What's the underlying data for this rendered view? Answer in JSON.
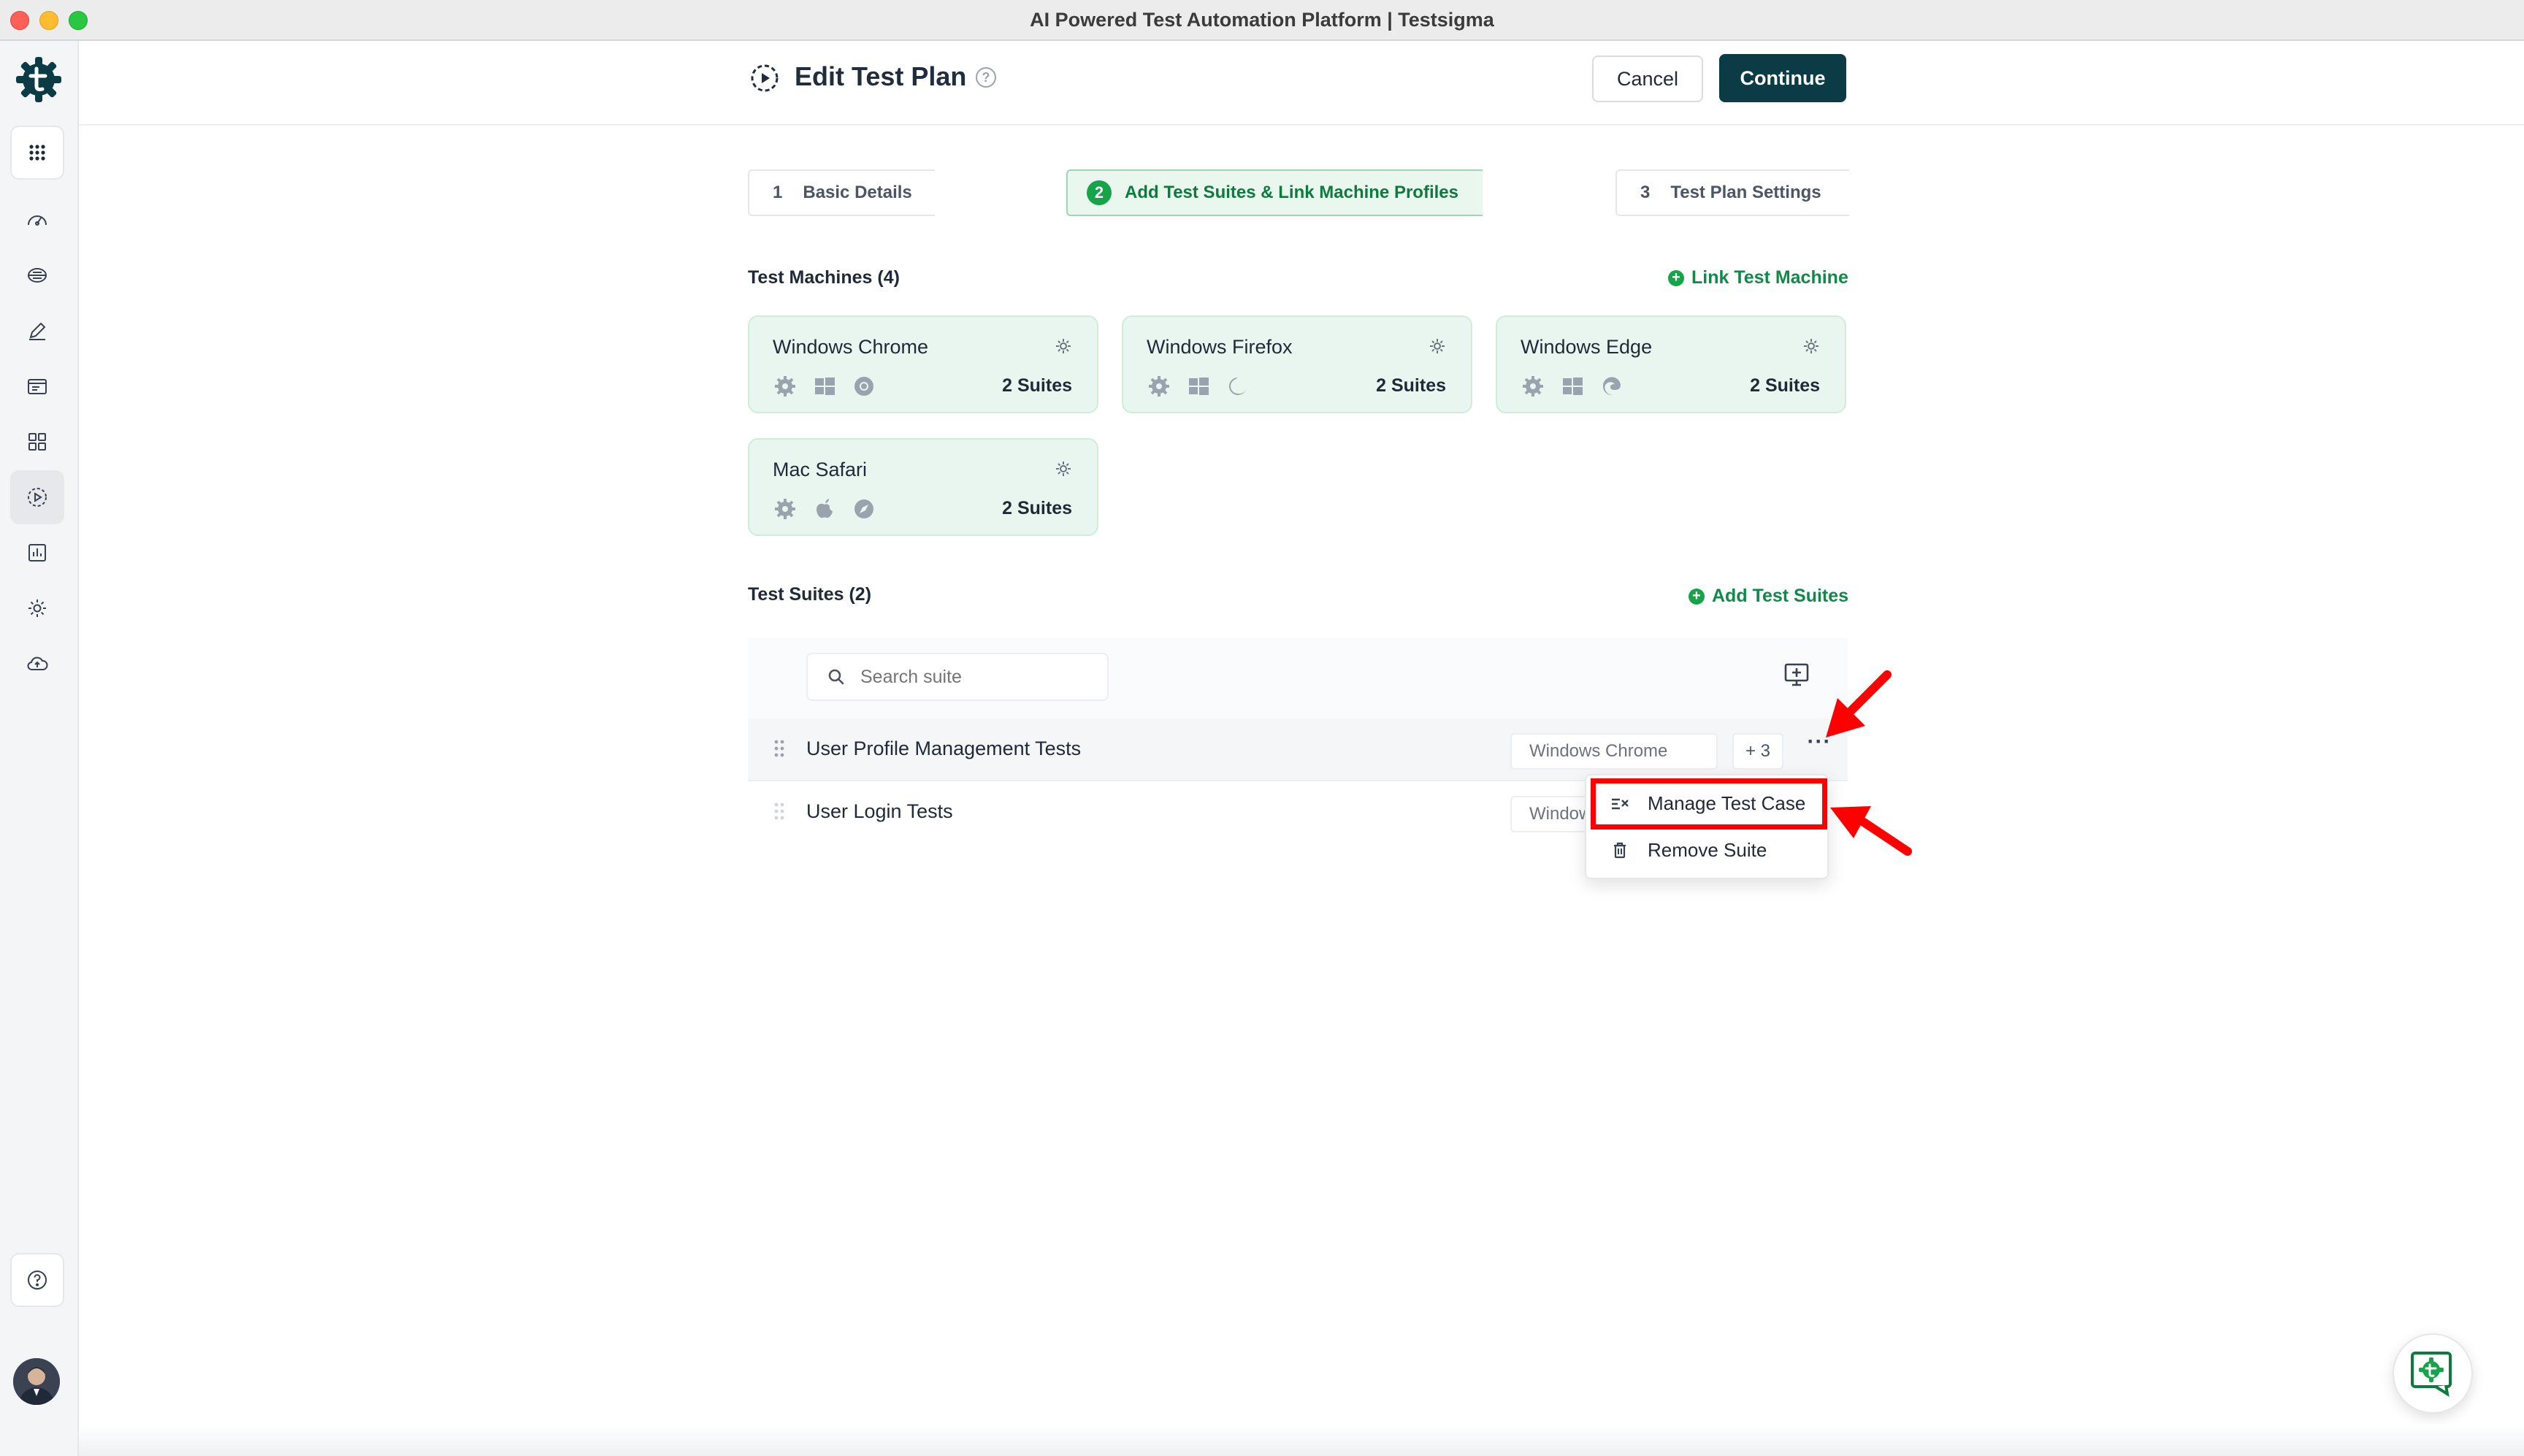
{
  "window": {
    "title": "AI Powered Test Automation Platform | Testsigma"
  },
  "header": {
    "title": "Edit Test Plan",
    "cancel_label": "Cancel",
    "continue_label": "Continue",
    "help_glyph": "?"
  },
  "rail": {
    "items": [
      "apps-grid-icon",
      "dashboard-icon",
      "test-development-icon",
      "edit-icon",
      "test-suites-icon",
      "elements-icon",
      "test-plans-icon",
      "reports-icon",
      "settings-icon",
      "cloud-upload-icon"
    ],
    "active": "test-plans-icon",
    "help_glyph": "?"
  },
  "stepper": {
    "steps": [
      {
        "num": "1",
        "label": "Basic Details",
        "active": false
      },
      {
        "num": "2",
        "label": "Add Test Suites & Link Machine Profiles",
        "active": true
      },
      {
        "num": "3",
        "label": "Test Plan Settings",
        "active": false
      }
    ]
  },
  "machines": {
    "title": "Test Machines (4)",
    "link_label": "Link Test Machine",
    "cards": [
      {
        "name": "Windows Chrome",
        "count": "2 Suites",
        "os": "windows-icon",
        "browser": "chrome-icon"
      },
      {
        "name": "Windows Firefox",
        "count": "2 Suites",
        "os": "windows-icon",
        "browser": "firefox-icon"
      },
      {
        "name": "Windows Edge",
        "count": "2 Suites",
        "os": "windows-icon",
        "browser": "edge-icon"
      },
      {
        "name": "Mac Safari",
        "count": "2 Suites",
        "os": "apple-icon",
        "browser": "safari-icon"
      }
    ]
  },
  "suites": {
    "title": "Test Suites (2)",
    "add_label": "Add Test Suites",
    "search_placeholder": "Search suite",
    "rows": [
      {
        "name": "User Profile Management Tests",
        "machine": "Windows Chrome",
        "more": "+ 3"
      },
      {
        "name": "User Login Tests",
        "machine": "Windows Chrome"
      }
    ]
  },
  "menu": {
    "items": [
      {
        "label": "Manage Test Case",
        "icon": "manage-list-icon"
      },
      {
        "label": "Remove Suite",
        "icon": "trash-icon"
      }
    ]
  },
  "colors": {
    "brand_dark": "#0b3b44",
    "accent_green": "#16a34a",
    "card_bg": "#e8f6ef",
    "annotation_red": "#ff0000"
  }
}
